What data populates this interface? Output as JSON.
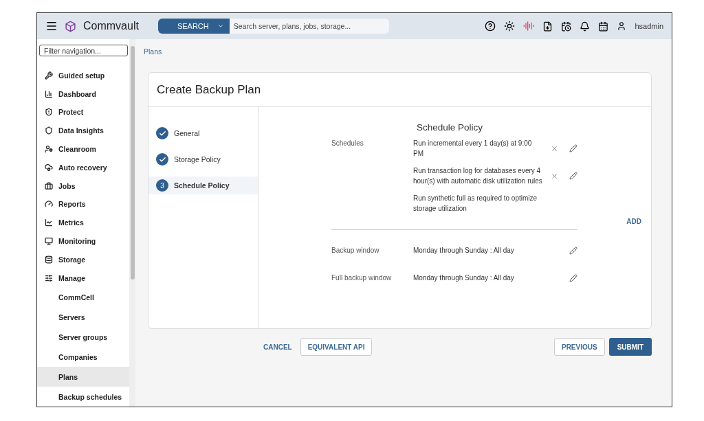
{
  "header": {
    "brand": "Commvault",
    "search_button": "SEARCH",
    "search": {
      "placeholder": "Search server, plans, jobs, storage..."
    },
    "user": "hsadmin"
  },
  "sidebar": {
    "filter": {
      "placeholder": "Filter navigation..."
    },
    "items": [
      {
        "label": "Guided setup",
        "kind": "top",
        "selected": false
      },
      {
        "label": "Dashboard",
        "kind": "top",
        "selected": false
      },
      {
        "label": "Protect",
        "kind": "top",
        "selected": false
      },
      {
        "label": "Data Insights",
        "kind": "top",
        "selected": false
      },
      {
        "label": "Cleanroom",
        "kind": "top",
        "selected": false
      },
      {
        "label": "Auto recovery",
        "kind": "top",
        "selected": false
      },
      {
        "label": "Jobs",
        "kind": "top",
        "selected": false
      },
      {
        "label": "Reports",
        "kind": "top",
        "selected": false
      },
      {
        "label": "Metrics",
        "kind": "top",
        "selected": false
      },
      {
        "label": "Monitoring",
        "kind": "top",
        "selected": false
      },
      {
        "label": "Storage",
        "kind": "top",
        "selected": false
      },
      {
        "label": "Manage",
        "kind": "top",
        "selected": false
      },
      {
        "label": "CommCell",
        "kind": "sub",
        "selected": false
      },
      {
        "label": "Servers",
        "kind": "sub",
        "selected": false
      },
      {
        "label": "Server groups",
        "kind": "sub",
        "selected": false
      },
      {
        "label": "Companies",
        "kind": "sub",
        "selected": false
      },
      {
        "label": "Plans",
        "kind": "sub",
        "selected": true
      },
      {
        "label": "Backup schedules",
        "kind": "sub",
        "selected": false
      }
    ]
  },
  "breadcrumb": "Plans",
  "wizard": {
    "title": "Create Backup Plan",
    "steps": [
      {
        "label": "General",
        "completed": true,
        "selected": false
      },
      {
        "label": "Storage Policy",
        "completed": true,
        "selected": false
      },
      {
        "label": "Schedule Policy",
        "completed": false,
        "number": "3",
        "selected": true
      }
    ],
    "section_title": "Schedule Policy",
    "schedules_label": "Schedules",
    "schedules": [
      {
        "text": "Run incremental every 1 day(s) at 9:00 PM",
        "removable": true,
        "editable": true
      },
      {
        "text": "Run transaction log for databases every 4 hour(s) with automatic disk utilization rules",
        "removable": true,
        "editable": true
      },
      {
        "text": "Run synthetic full as required to optimize storage utilization",
        "removable": false,
        "editable": false
      }
    ],
    "add": "ADD",
    "windows": [
      {
        "label": "Backup window",
        "value": "Monday through Sunday : All day",
        "editable": true
      },
      {
        "label": "Full backup window",
        "value": "Monday through Sunday : All day",
        "editable": true
      }
    ]
  },
  "footer": {
    "cancel": "CANCEL",
    "api": "EQUIVALENT API",
    "previous": "PREVIOUS",
    "submit": "SUBMIT"
  }
}
